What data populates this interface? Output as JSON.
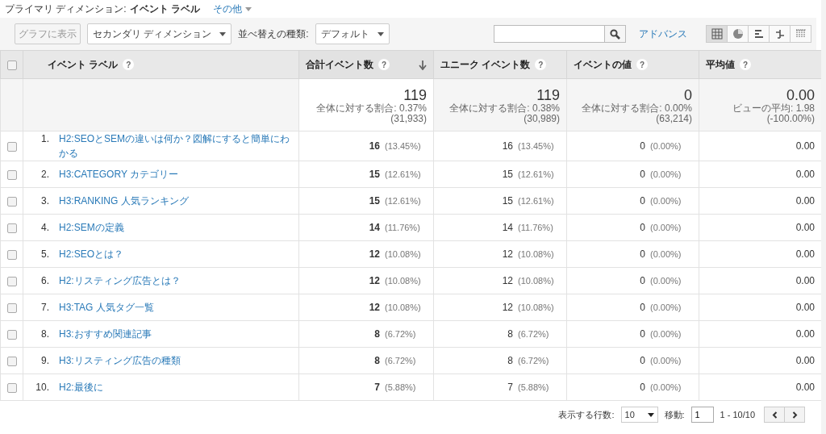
{
  "primary_dimension": {
    "label": "プライマリ ディメンション:",
    "value": "イベント ラベル",
    "other": "その他"
  },
  "toolbar": {
    "chart_button": {
      "label": "グラフに表示",
      "disabled": true
    },
    "secondary_dimension": "セカンダリ ディメンション",
    "sort_label": "並べ替えの種類:",
    "sort_value": "デフォルト",
    "advanced": "アドバンス",
    "views": [
      {
        "kind": "table",
        "selected": true
      },
      {
        "kind": "pie",
        "selected": false
      },
      {
        "kind": "bars",
        "selected": false
      },
      {
        "kind": "compare",
        "selected": false
      },
      {
        "kind": "pivot",
        "selected": false
      }
    ]
  },
  "table": {
    "select_all_checked": false,
    "columns": [
      {
        "label": "イベント ラベル",
        "help": "?",
        "sorted": false
      },
      {
        "label": "合計イベント数",
        "help": "?",
        "sorted": true
      },
      {
        "label": "ユニーク イベント数",
        "help": "?",
        "sorted": false
      },
      {
        "label": "イベントの値",
        "help": "?",
        "sorted": false
      },
      {
        "label": "平均値",
        "help": "?",
        "sorted": false
      }
    ],
    "summary": [
      {
        "value": "119",
        "line1": "全体に対する割合: 0.37%",
        "line2": "(31,933)"
      },
      {
        "value": "119",
        "line1": "全体に対する割合: 0.38%",
        "line2": "(30,989)"
      },
      {
        "value": "0",
        "line1": "全体に対する割合: 0.00%",
        "line2": "(63,214)"
      },
      {
        "value": "0.00",
        "line1": "ビューの平均: 1.98",
        "line2": "(-100.00%)"
      }
    ],
    "rows": [
      {
        "checked": false,
        "index": "1.",
        "label": "H2:SEOとSEMの違いは何か？図解にすると簡単にわかる",
        "total": "16",
        "total_pct": "(13.45%)",
        "unique": "16",
        "unique_pct": "(13.45%)",
        "value": "0",
        "value_pct": "(0.00%)",
        "avg": "0.00"
      },
      {
        "checked": false,
        "index": "2.",
        "label": "H3:CATEGORY カテゴリー",
        "total": "15",
        "total_pct": "(12.61%)",
        "unique": "15",
        "unique_pct": "(12.61%)",
        "value": "0",
        "value_pct": "(0.00%)",
        "avg": "0.00"
      },
      {
        "checked": false,
        "index": "3.",
        "label": "H3:RANKING 人気ランキング",
        "total": "15",
        "total_pct": "(12.61%)",
        "unique": "15",
        "unique_pct": "(12.61%)",
        "value": "0",
        "value_pct": "(0.00%)",
        "avg": "0.00"
      },
      {
        "checked": false,
        "index": "4.",
        "label": "H2:SEMの定義",
        "total": "14",
        "total_pct": "(11.76%)",
        "unique": "14",
        "unique_pct": "(11.76%)",
        "value": "0",
        "value_pct": "(0.00%)",
        "avg": "0.00"
      },
      {
        "checked": false,
        "index": "5.",
        "label": "H2:SEOとは？",
        "total": "12",
        "total_pct": "(10.08%)",
        "unique": "12",
        "unique_pct": "(10.08%)",
        "value": "0",
        "value_pct": "(0.00%)",
        "avg": "0.00"
      },
      {
        "checked": false,
        "index": "6.",
        "label": "H2:リスティング広告とは？",
        "total": "12",
        "total_pct": "(10.08%)",
        "unique": "12",
        "unique_pct": "(10.08%)",
        "value": "0",
        "value_pct": "(0.00%)",
        "avg": "0.00"
      },
      {
        "checked": false,
        "index": "7.",
        "label": "H3:TAG 人気タグ一覧",
        "total": "12",
        "total_pct": "(10.08%)",
        "unique": "12",
        "unique_pct": "(10.08%)",
        "value": "0",
        "value_pct": "(0.00%)",
        "avg": "0.00"
      },
      {
        "checked": false,
        "index": "8.",
        "label": "H3:おすすめ関連記事",
        "total": "8",
        "total_pct": "(6.72%)",
        "unique": "8",
        "unique_pct": "(6.72%)",
        "value": "0",
        "value_pct": "(0.00%)",
        "avg": "0.00"
      },
      {
        "checked": false,
        "index": "9.",
        "label": "H3:リスティング広告の種類",
        "total": "8",
        "total_pct": "(6.72%)",
        "unique": "8",
        "unique_pct": "(6.72%)",
        "value": "0",
        "value_pct": "(0.00%)",
        "avg": "0.00"
      },
      {
        "checked": false,
        "index": "10.",
        "label": "H2:最後に",
        "total": "7",
        "total_pct": "(5.88%)",
        "unique": "7",
        "unique_pct": "(5.88%)",
        "value": "0",
        "value_pct": "(0.00%)",
        "avg": "0.00"
      }
    ]
  },
  "pagination": {
    "rows_label": "表示する行数:",
    "rows_value": "10",
    "goto_label": "移動:",
    "goto_value": "1",
    "range": "1 - 10/10"
  }
}
